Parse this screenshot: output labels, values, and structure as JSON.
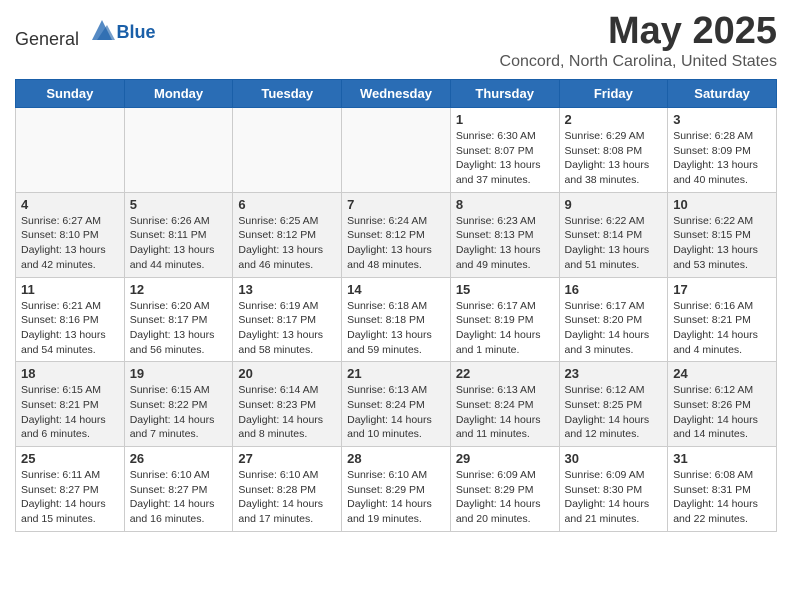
{
  "header": {
    "logo_general": "General",
    "logo_blue": "Blue",
    "month_title": "May 2025",
    "location": "Concord, North Carolina, United States"
  },
  "days_of_week": [
    "Sunday",
    "Monday",
    "Tuesday",
    "Wednesday",
    "Thursday",
    "Friday",
    "Saturday"
  ],
  "weeks": [
    [
      {
        "day": "",
        "info": ""
      },
      {
        "day": "",
        "info": ""
      },
      {
        "day": "",
        "info": ""
      },
      {
        "day": "",
        "info": ""
      },
      {
        "day": "1",
        "info": "Sunrise: 6:30 AM\nSunset: 8:07 PM\nDaylight: 13 hours\nand 37 minutes."
      },
      {
        "day": "2",
        "info": "Sunrise: 6:29 AM\nSunset: 8:08 PM\nDaylight: 13 hours\nand 38 minutes."
      },
      {
        "day": "3",
        "info": "Sunrise: 6:28 AM\nSunset: 8:09 PM\nDaylight: 13 hours\nand 40 minutes."
      }
    ],
    [
      {
        "day": "4",
        "info": "Sunrise: 6:27 AM\nSunset: 8:10 PM\nDaylight: 13 hours\nand 42 minutes."
      },
      {
        "day": "5",
        "info": "Sunrise: 6:26 AM\nSunset: 8:11 PM\nDaylight: 13 hours\nand 44 minutes."
      },
      {
        "day": "6",
        "info": "Sunrise: 6:25 AM\nSunset: 8:12 PM\nDaylight: 13 hours\nand 46 minutes."
      },
      {
        "day": "7",
        "info": "Sunrise: 6:24 AM\nSunset: 8:12 PM\nDaylight: 13 hours\nand 48 minutes."
      },
      {
        "day": "8",
        "info": "Sunrise: 6:23 AM\nSunset: 8:13 PM\nDaylight: 13 hours\nand 49 minutes."
      },
      {
        "day": "9",
        "info": "Sunrise: 6:22 AM\nSunset: 8:14 PM\nDaylight: 13 hours\nand 51 minutes."
      },
      {
        "day": "10",
        "info": "Sunrise: 6:22 AM\nSunset: 8:15 PM\nDaylight: 13 hours\nand 53 minutes."
      }
    ],
    [
      {
        "day": "11",
        "info": "Sunrise: 6:21 AM\nSunset: 8:16 PM\nDaylight: 13 hours\nand 54 minutes."
      },
      {
        "day": "12",
        "info": "Sunrise: 6:20 AM\nSunset: 8:17 PM\nDaylight: 13 hours\nand 56 minutes."
      },
      {
        "day": "13",
        "info": "Sunrise: 6:19 AM\nSunset: 8:17 PM\nDaylight: 13 hours\nand 58 minutes."
      },
      {
        "day": "14",
        "info": "Sunrise: 6:18 AM\nSunset: 8:18 PM\nDaylight: 13 hours\nand 59 minutes."
      },
      {
        "day": "15",
        "info": "Sunrise: 6:17 AM\nSunset: 8:19 PM\nDaylight: 14 hours\nand 1 minute."
      },
      {
        "day": "16",
        "info": "Sunrise: 6:17 AM\nSunset: 8:20 PM\nDaylight: 14 hours\nand 3 minutes."
      },
      {
        "day": "17",
        "info": "Sunrise: 6:16 AM\nSunset: 8:21 PM\nDaylight: 14 hours\nand 4 minutes."
      }
    ],
    [
      {
        "day": "18",
        "info": "Sunrise: 6:15 AM\nSunset: 8:21 PM\nDaylight: 14 hours\nand 6 minutes."
      },
      {
        "day": "19",
        "info": "Sunrise: 6:15 AM\nSunset: 8:22 PM\nDaylight: 14 hours\nand 7 minutes."
      },
      {
        "day": "20",
        "info": "Sunrise: 6:14 AM\nSunset: 8:23 PM\nDaylight: 14 hours\nand 8 minutes."
      },
      {
        "day": "21",
        "info": "Sunrise: 6:13 AM\nSunset: 8:24 PM\nDaylight: 14 hours\nand 10 minutes."
      },
      {
        "day": "22",
        "info": "Sunrise: 6:13 AM\nSunset: 8:24 PM\nDaylight: 14 hours\nand 11 minutes."
      },
      {
        "day": "23",
        "info": "Sunrise: 6:12 AM\nSunset: 8:25 PM\nDaylight: 14 hours\nand 12 minutes."
      },
      {
        "day": "24",
        "info": "Sunrise: 6:12 AM\nSunset: 8:26 PM\nDaylight: 14 hours\nand 14 minutes."
      }
    ],
    [
      {
        "day": "25",
        "info": "Sunrise: 6:11 AM\nSunset: 8:27 PM\nDaylight: 14 hours\nand 15 minutes."
      },
      {
        "day": "26",
        "info": "Sunrise: 6:10 AM\nSunset: 8:27 PM\nDaylight: 14 hours\nand 16 minutes."
      },
      {
        "day": "27",
        "info": "Sunrise: 6:10 AM\nSunset: 8:28 PM\nDaylight: 14 hours\nand 17 minutes."
      },
      {
        "day": "28",
        "info": "Sunrise: 6:10 AM\nSunset: 8:29 PM\nDaylight: 14 hours\nand 19 minutes."
      },
      {
        "day": "29",
        "info": "Sunrise: 6:09 AM\nSunset: 8:29 PM\nDaylight: 14 hours\nand 20 minutes."
      },
      {
        "day": "30",
        "info": "Sunrise: 6:09 AM\nSunset: 8:30 PM\nDaylight: 14 hours\nand 21 minutes."
      },
      {
        "day": "31",
        "info": "Sunrise: 6:08 AM\nSunset: 8:31 PM\nDaylight: 14 hours\nand 22 minutes."
      }
    ]
  ]
}
